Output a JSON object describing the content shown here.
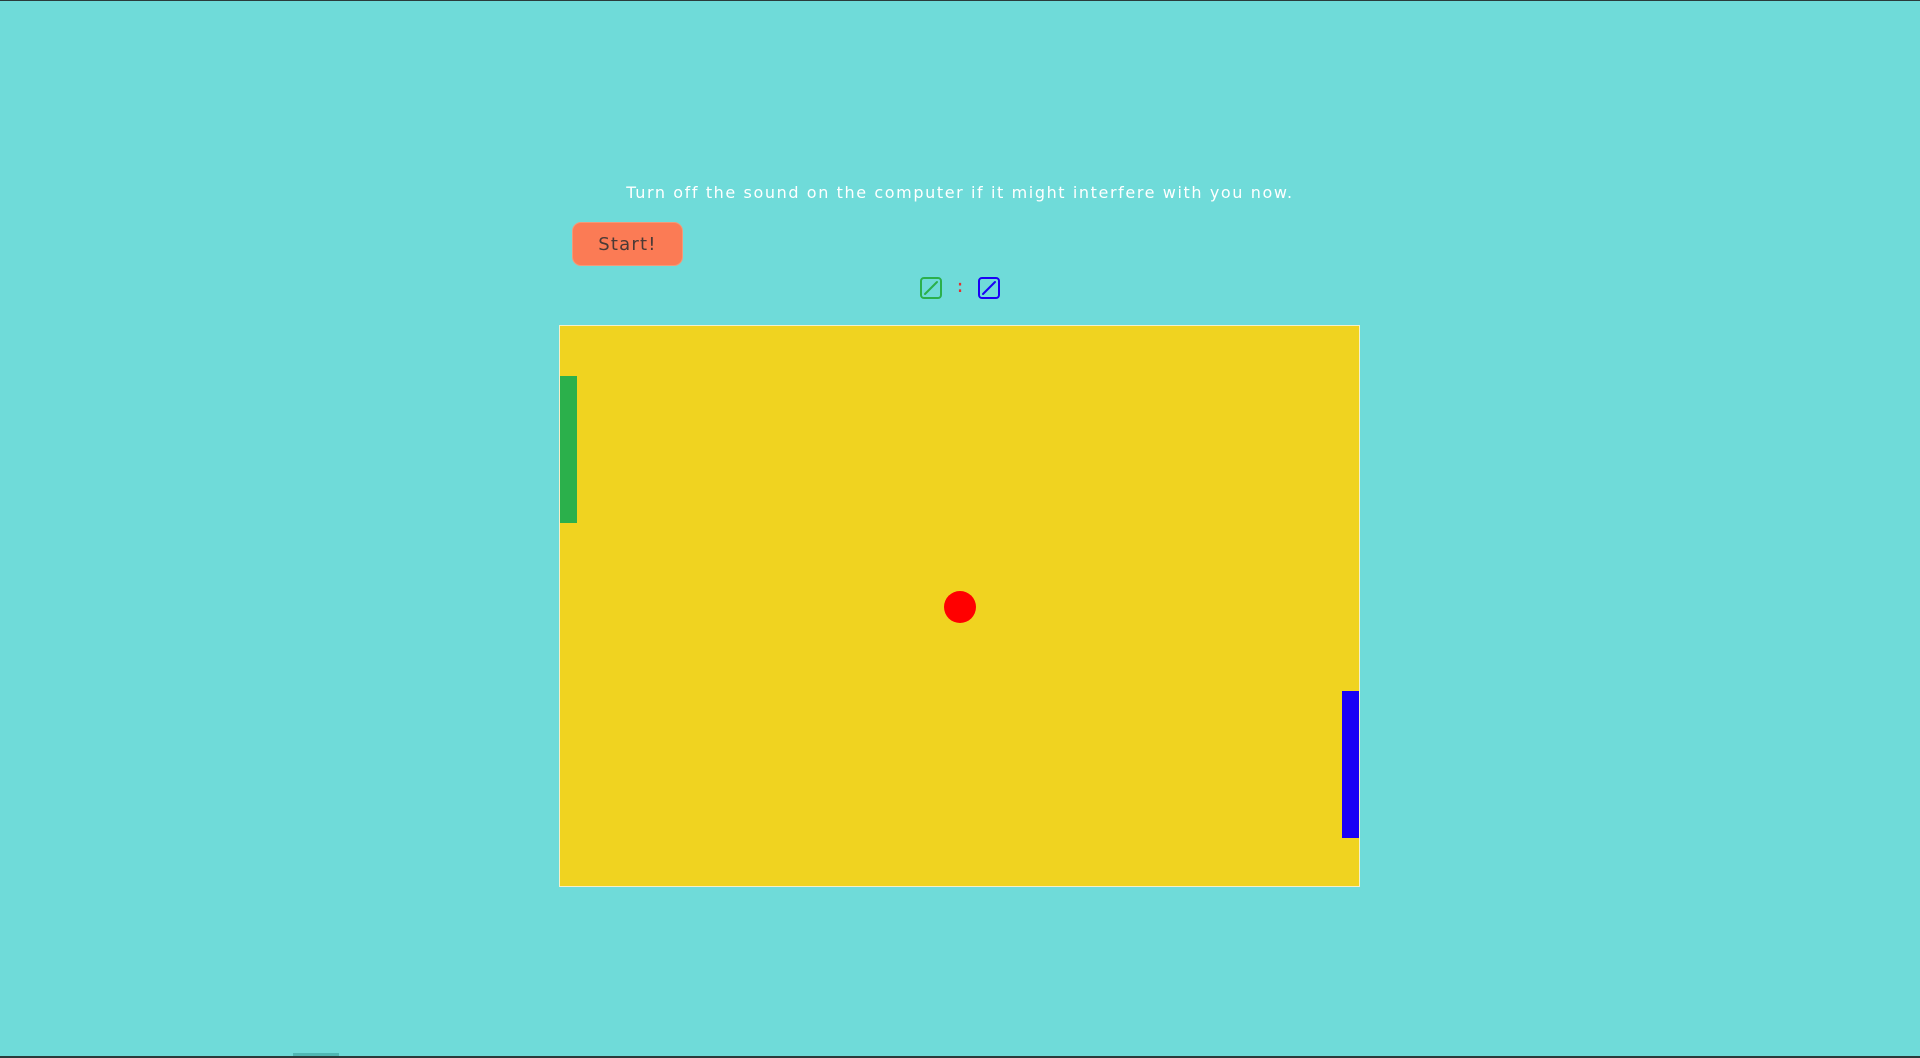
{
  "notice": {
    "text": "Turn off the sound on the computer if it might interfere with you now."
  },
  "controls": {
    "start_label": "Start!"
  },
  "scoreboard": {
    "separator": ":",
    "left_icon": "slashed-square-icon",
    "right_icon": "slashed-square-icon"
  },
  "colors": {
    "background": "#6fdbd9",
    "court": "#f0d320",
    "start_button": "#fb7b55",
    "left_player": "#2bb04b",
    "right_player": "#1a00f5",
    "ball": "#ff0000",
    "separator": "#e33030"
  }
}
